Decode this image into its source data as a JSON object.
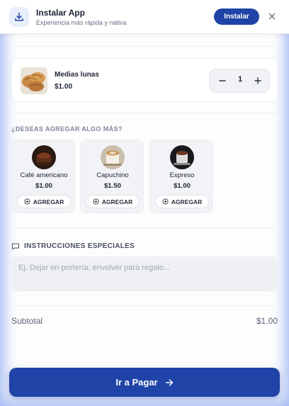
{
  "colors": {
    "accent": "#1f43a6",
    "text": "#1d2433",
    "muted": "#7d8598"
  },
  "install_banner": {
    "title": "Instalar App",
    "subtitle": "Experiencia más rápida y nativa",
    "button_label": "Instalar",
    "icon": "download-icon",
    "close_icon": "close-icon"
  },
  "cart_item": {
    "name": "Medias lunas",
    "price": "$1.00",
    "quantity": "1",
    "minus_icon": "minus-icon",
    "plus_icon": "plus-icon"
  },
  "upsell": {
    "heading": "¿DESEAS AGREGAR ALGO MÁS?",
    "add_label": "AGREGAR",
    "items": [
      {
        "name": "Café americano",
        "price": "$1.00"
      },
      {
        "name": "Capuchino",
        "price": "$1.50"
      },
      {
        "name": "Expreso",
        "price": "$1.00"
      }
    ]
  },
  "instructions": {
    "heading": "INSTRUCCIONES ESPECIALES",
    "placeholder": "Ej. Dejar en portería, envolver para regalo...",
    "value": ""
  },
  "summary": {
    "subtotal_label": "Subtotal",
    "subtotal_value": "$1.00"
  },
  "checkout": {
    "label": "Ir a Pagar",
    "icon": "arrow-right-icon"
  }
}
